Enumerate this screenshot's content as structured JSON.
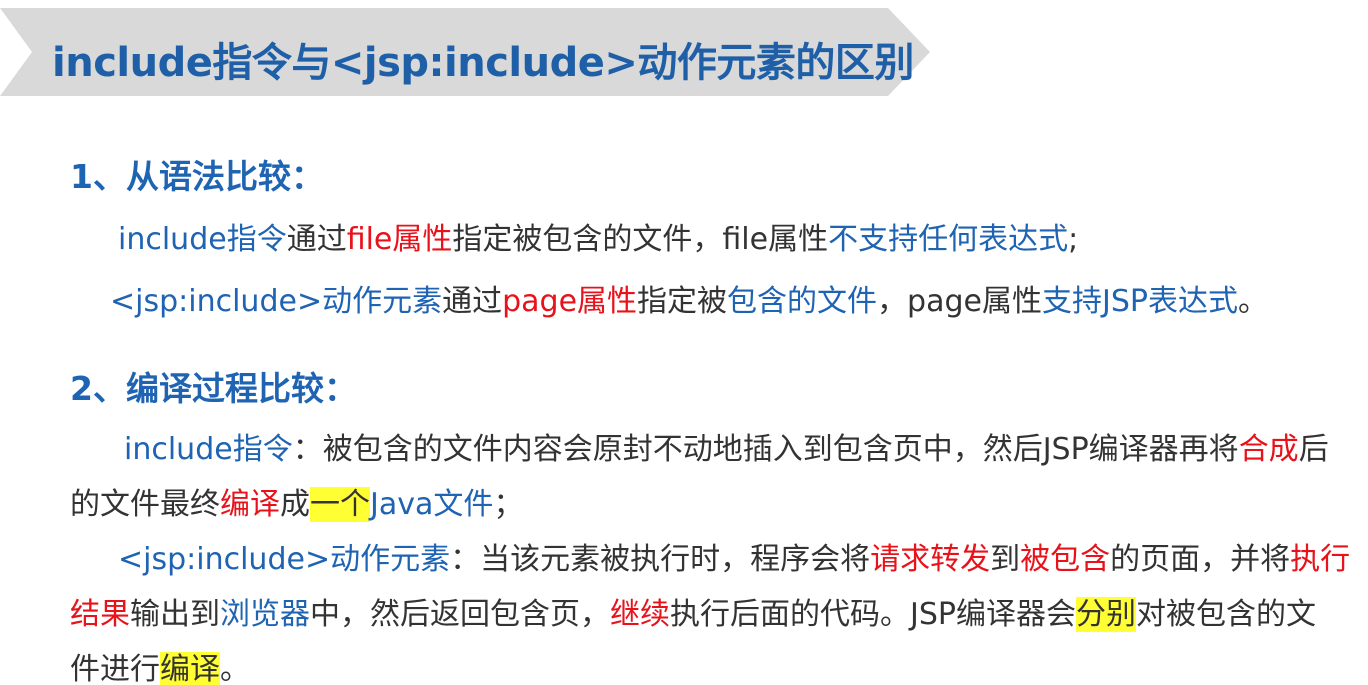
{
  "title": "include指令与<jsp:include>动作元素的区别",
  "section1": {
    "heading": "1、从语法比较：",
    "line1": {
      "a": "include指令",
      "b": "通过",
      "c": "file属性",
      "d": "指定被包含的文件，file属性",
      "e": "不支持任何表达式",
      "f": ";"
    },
    "line2": {
      "a": "<jsp:include>动作元素",
      "b": "通过",
      "c": "page属性",
      "d": "指定被",
      "e": "包含的文件",
      "f": "，page属性",
      "g": "支持JSP表达式",
      "h": "。"
    }
  },
  "section2": {
    "heading": "2、编译过程比较：",
    "p1": {
      "a": "include指令",
      "b": "：被包含的文件内容会原封不动地插入到包含页中，然后JSP编译器再将",
      "c": "合成",
      "d": "后",
      "e": "的文件最终",
      "f": "编译",
      "g": "成",
      "h": "一个",
      "i": "Java文件",
      "j": "；"
    },
    "p2": {
      "a": "<jsp:include>动作元素",
      "b": "：当该元素被执行时，程序会将",
      "c": "请求转发",
      "d": "到",
      "e": "被包含",
      "f": "的页面，并将",
      "g": "执行",
      "h": "结果",
      "i": "输出到",
      "j": "浏览器",
      "k": "中，然后返回包含页，",
      "l": "继续",
      "m": "执行后面的代码。JSP编译器会",
      "n": "分别",
      "o": "对被包含的文",
      "p": "件进行",
      "q": "编译",
      "r": "。"
    }
  },
  "colors": {
    "accent_blue": "#1f63b3",
    "emphasis_red": "#e8121b",
    "highlight_yellow": "#ffff33",
    "banner_gray": "#d9d9d9"
  }
}
